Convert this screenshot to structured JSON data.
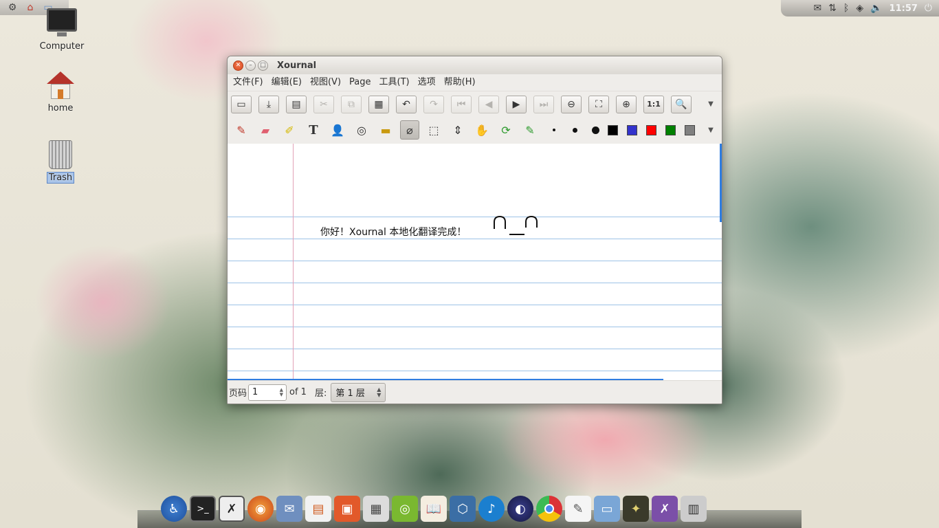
{
  "panel": {
    "left_icons": [
      "ubuntu-logo-icon",
      "home-folder-icon",
      "folder-icon"
    ],
    "tray_icons": [
      "mail-icon",
      "network-icon",
      "bluetooth-icon",
      "dropbox-icon",
      "volume-icon",
      "power-icon"
    ],
    "clock": "11:57"
  },
  "desktop": {
    "icons": [
      {
        "name": "computer",
        "label": "Computer"
      },
      {
        "name": "home",
        "label": "home"
      },
      {
        "name": "trash",
        "label": "Trash"
      }
    ]
  },
  "window": {
    "title": "Xournal",
    "menu": [
      "文件(F)",
      "编辑(E)",
      "视图(V)",
      "Page",
      "工具(T)",
      "选项",
      "帮助(H)"
    ],
    "toolbar_glyphs": {
      "new": "▭",
      "open": "⤓",
      "save": "▤",
      "cut": "✂",
      "copy": "⧉",
      "paste": "▦",
      "undo": "↶",
      "redo": "↷",
      "first": "⏮",
      "prev": "◀",
      "next": "▶",
      "last": "⏭",
      "zoom_out": "⊖",
      "fit": "⛶",
      "zoom_in": "⊕",
      "normal": "1:1",
      "find": "🔍",
      "more": "▼"
    },
    "tools_glyphs": {
      "pen": "✎",
      "eraser": "▰",
      "highlighter": "✐",
      "text": "T",
      "image": "👤",
      "shape": "◎",
      "ruler": "▬",
      "lasso": "⌀",
      "rect_select": "⬚",
      "vertical_space": "⇕",
      "hand": "✋",
      "default_tools": "⟳",
      "default_pen": "✎"
    },
    "pen_colors": [
      "#000000",
      "#3333cc",
      "#ff0000",
      "#008000",
      "#808080"
    ],
    "note_text": "你好！Xournal 本地化翻译完成！",
    "status": {
      "page_label": "页码",
      "page_value": "1",
      "of_label": "of 1",
      "layer_label": "层:",
      "layer_value": "第 1 层"
    }
  },
  "dock": {
    "items": [
      "accessibility-icon",
      "terminal-icon",
      "xournal-icon",
      "firefox-icon",
      "thunderbird-icon",
      "libreoffice-icon",
      "software-center-icon",
      "calculator-icon",
      "cd-burner-icon",
      "book-icon",
      "virtualbox-icon",
      "music-icon",
      "eclipse-icon",
      "chrome-icon",
      "text-editor-icon",
      "folder-icon",
      "photo-icon",
      "xournal-window-icon",
      "workspace-icon"
    ]
  }
}
